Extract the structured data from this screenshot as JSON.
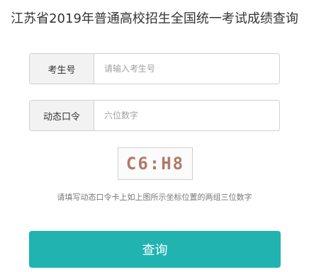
{
  "header": {
    "title": "江苏省2019年普通高校招生全国统一考试成绩查询"
  },
  "form": {
    "exam_number": {
      "label": "考生号",
      "placeholder": "请输入考生号",
      "value": ""
    },
    "dynamic_password": {
      "label": "动态口令",
      "placeholder": "六位数字",
      "value": ""
    },
    "captcha_code": "C6:H8",
    "hint": "请填写动态口令卡上如上图所示坐标位置的两组三位数字",
    "submit_label": "查询"
  },
  "colors": {
    "accent": "#20b3b0",
    "label_bg": "#f2f2f2",
    "border": "#cfcfcf",
    "captcha_text": "#b07a68"
  }
}
